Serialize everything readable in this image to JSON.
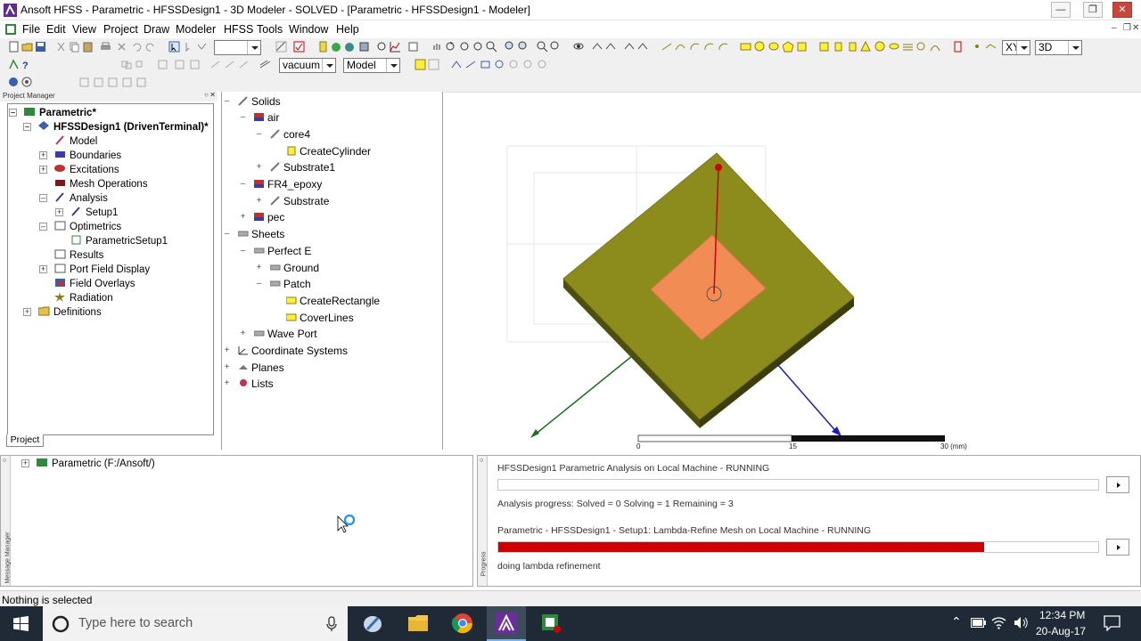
{
  "window": {
    "title": "Ansoft HFSS - Parametric - HFSSDesign1 - 3D Modeler - SOLVED - [Parametric - HFSSDesign1 - Modeler]"
  },
  "menu": [
    "File",
    "Edit",
    "View",
    "Project",
    "Draw",
    "Modeler",
    "HFSS",
    "Tools",
    "Window",
    "Help"
  ],
  "toolbar": {
    "material": "vacuum",
    "model": "Model",
    "plane": "XY",
    "view": "3D"
  },
  "project_manager": {
    "header": "Project Manager",
    "tab": "Project",
    "tree": [
      {
        "label": "Parametric*",
        "bold": true
      },
      {
        "label": "HFSSDesign1 (DrivenTerminal)*",
        "bold": true
      },
      {
        "label": "Model"
      },
      {
        "label": "Boundaries"
      },
      {
        "label": "Excitations"
      },
      {
        "label": "Mesh Operations"
      },
      {
        "label": "Analysis"
      },
      {
        "label": "Setup1"
      },
      {
        "label": "Optimetrics"
      },
      {
        "label": "ParametricSetup1"
      },
      {
        "label": "Results"
      },
      {
        "label": "Port Field Display"
      },
      {
        "label": "Field Overlays"
      },
      {
        "label": "Radiation"
      },
      {
        "label": "Definitions"
      }
    ]
  },
  "history_tree": [
    {
      "label": "Solids"
    },
    {
      "label": "air"
    },
    {
      "label": "core4"
    },
    {
      "label": "CreateCylinder"
    },
    {
      "label": "Substrate1"
    },
    {
      "label": "FR4_epoxy"
    },
    {
      "label": "Substrate"
    },
    {
      "label": "pec"
    },
    {
      "label": "Sheets"
    },
    {
      "label": "Perfect E"
    },
    {
      "label": "Ground"
    },
    {
      "label": "Patch"
    },
    {
      "label": "CreateRectangle"
    },
    {
      "label": "CoverLines"
    },
    {
      "label": "Wave Port"
    },
    {
      "label": "Coordinate Systems"
    },
    {
      "label": "Planes"
    },
    {
      "label": "Lists"
    }
  ],
  "viewport": {
    "ruler_ticks": [
      "0",
      "15",
      "30 (mm)"
    ],
    "colors": {
      "substrate": "#8c8c1c",
      "patch": "#f28c55",
      "axis_z": "#cc0000",
      "axis_x": "#1f6f1f",
      "axis_y": "#0000cc"
    }
  },
  "message_manager": {
    "side_label": "Message Manager",
    "node": "Parametric (F:/Ansoft/)"
  },
  "progress": {
    "side_label": "Progress",
    "job1_title": "HFSSDesign1 Parametric Analysis on Local Machine - RUNNING",
    "job1_status": "Analysis progress:   Solved = 0   Solving = 1   Remaining = 3",
    "job1_fraction": 0.0,
    "job2_title": "Parametric - HFSSDesign1 - Setup1: Lambda-Refine Mesh on Local Machine - RUNNING",
    "job2_status": "doing lambda refinement",
    "job2_fraction": 0.81,
    "bar_color": "#cc0000"
  },
  "status_bar": {
    "text": "Nothing is selected"
  },
  "taskbar": {
    "search_placeholder": "Type here to search",
    "time": "12:34 PM",
    "date": "20-Aug-17"
  }
}
